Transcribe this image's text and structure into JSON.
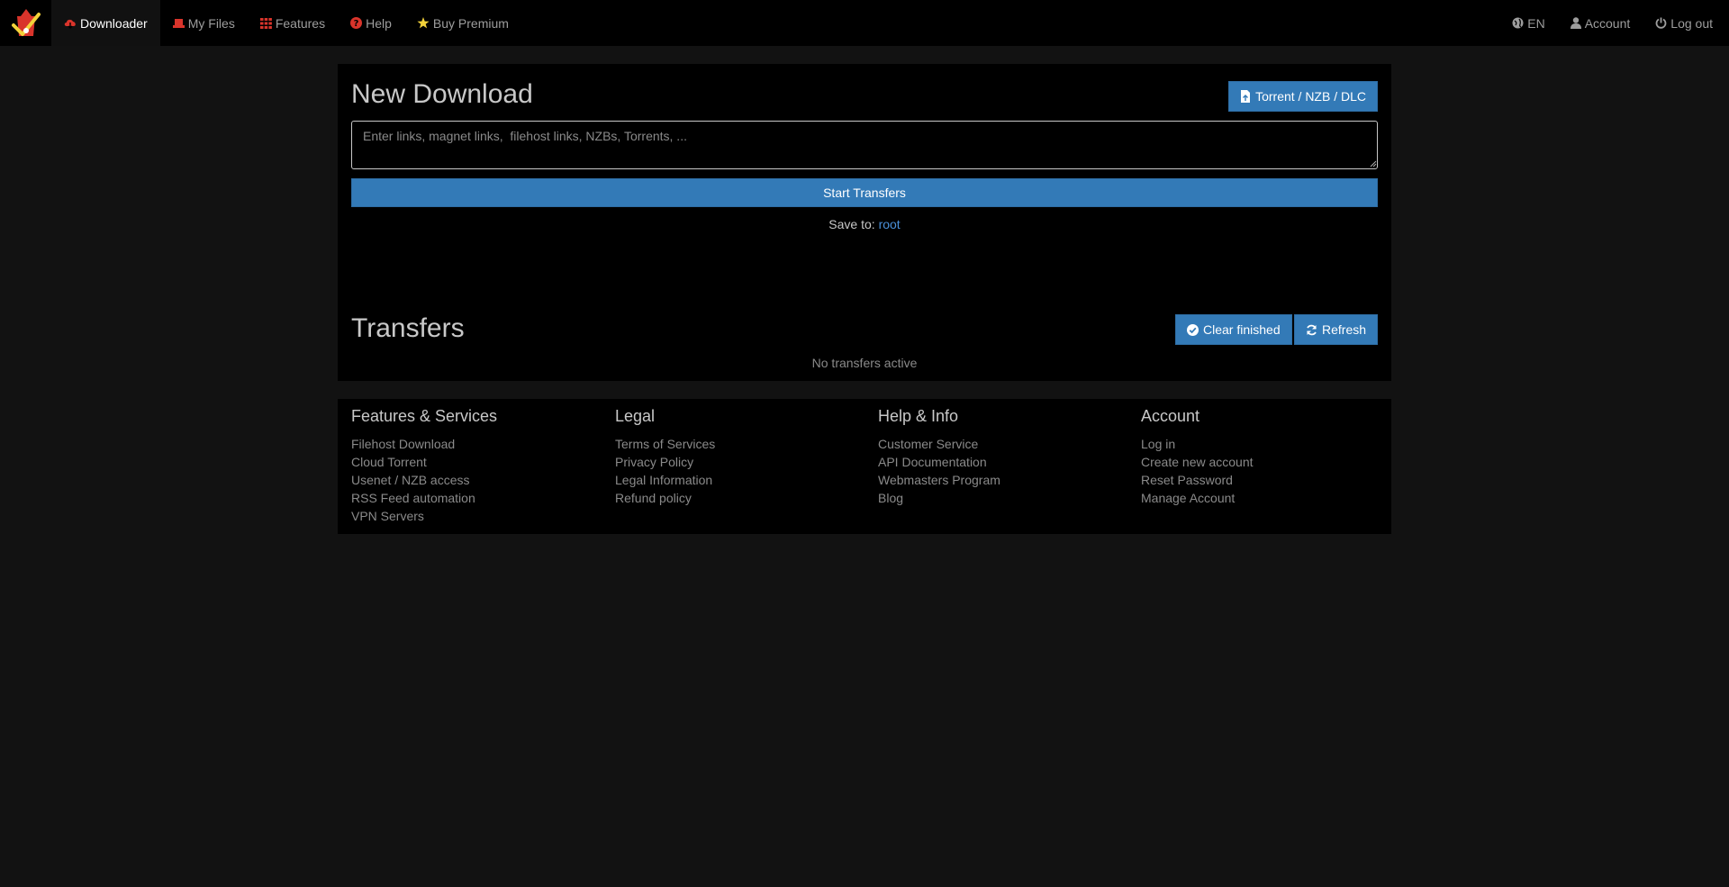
{
  "nav": {
    "left": [
      {
        "label": "Downloader",
        "icon": "cloud-download-icon"
      },
      {
        "label": "My Files",
        "icon": "hdd-icon"
      },
      {
        "label": "Features",
        "icon": "grid-icon"
      },
      {
        "label": "Help",
        "icon": "question-circle-icon"
      },
      {
        "label": "Buy Premium",
        "icon": "star-icon"
      }
    ],
    "right": [
      {
        "label": "EN",
        "icon": "globe-icon"
      },
      {
        "label": "Account",
        "icon": "user-icon"
      },
      {
        "label": "Log out",
        "icon": "power-icon"
      }
    ]
  },
  "download": {
    "title": "New Download",
    "torrent_button": "Torrent / NZB / DLC",
    "links_placeholder": "Enter links, magnet links,  filehost links, NZBs, Torrents, ...",
    "start_button": "Start Transfers",
    "save_to_label": "Save to:",
    "save_to_value": "root"
  },
  "transfers": {
    "title": "Transfers",
    "clear_button": "Clear finished",
    "refresh_button": "Refresh",
    "empty_text": "No transfers active"
  },
  "footer": {
    "columns": [
      {
        "heading": "Features & Services",
        "links": [
          "Filehost Download",
          "Cloud Torrent",
          "Usenet / NZB access",
          "RSS Feed automation",
          "VPN Servers"
        ]
      },
      {
        "heading": "Legal",
        "links": [
          "Terms of Services",
          "Privacy Policy",
          "Legal Information",
          "Refund policy"
        ]
      },
      {
        "heading": "Help & Info",
        "links": [
          "Customer Service",
          "API Documentation",
          "Webmasters Program",
          "Blog"
        ]
      },
      {
        "heading": "Account",
        "links": [
          "Log in",
          "Create new account",
          "Reset Password",
          "Manage Account"
        ]
      }
    ]
  },
  "colors": {
    "accent": "#337ab7",
    "page_bg": "#121212",
    "panel_bg": "#000000",
    "brand_red": "#d9342b"
  }
}
